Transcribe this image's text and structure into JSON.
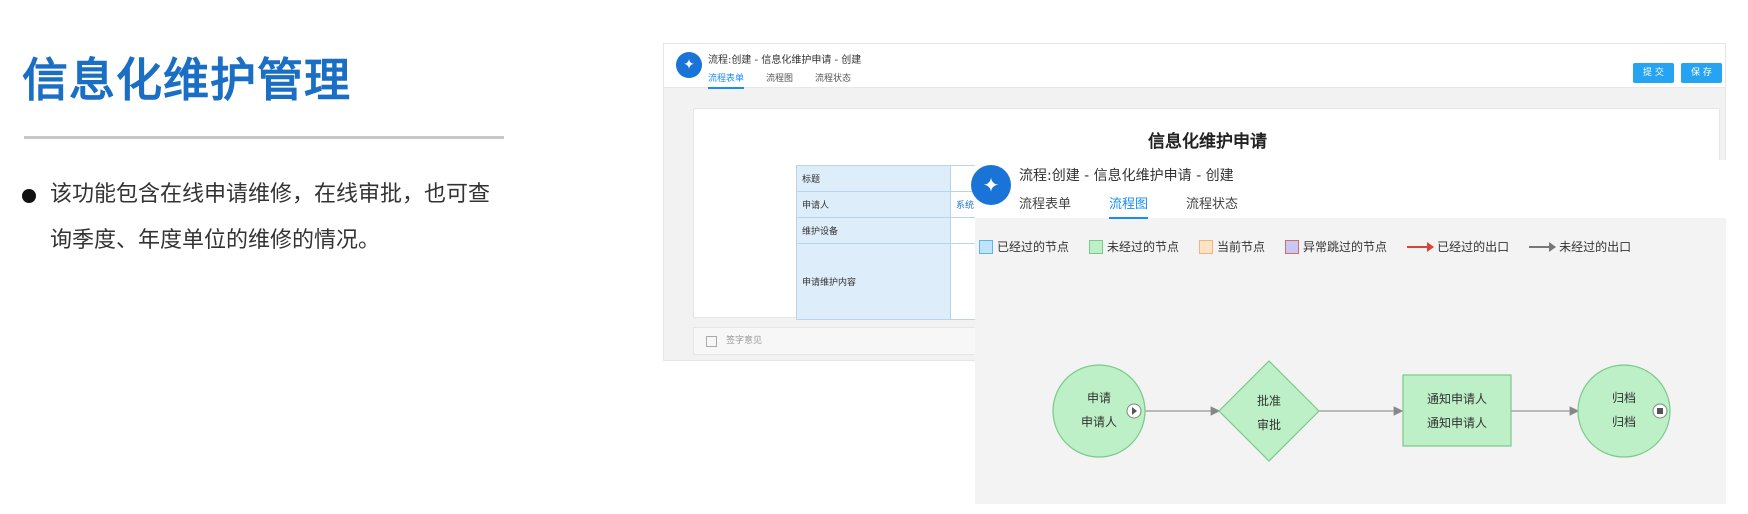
{
  "slide": {
    "title": "信息化维护管理",
    "bullet_line1": "该功能包含在线申请维修，在线审批，也可查",
    "bullet_line2": "询季度、年度单位的维修的情况。"
  },
  "back_window": {
    "title": "流程:创建 - 信息化维护申请 - 创建",
    "tabs": [
      "流程表单",
      "流程图",
      "流程状态"
    ],
    "submit_label": "提 交",
    "save_label": "保 存",
    "doc_title": "信息化维护申请",
    "fields": [
      "标题",
      "申请人",
      "维护设备",
      "申请维护内容"
    ],
    "applicant_value": "系统!",
    "footer_text": "签字意见"
  },
  "front_window": {
    "title": "流程:创建 - 信息化维护申请 - 创建",
    "tabs": [
      "流程表单",
      "流程图",
      "流程状态"
    ],
    "active_tab": "流程图",
    "legend": [
      {
        "label": "已经过的节点",
        "kind": "box",
        "fill": "#bfe3f9",
        "stroke": "#5bb6ea"
      },
      {
        "label": "未经过的节点",
        "kind": "box",
        "fill": "#bdf0c6",
        "stroke": "#7ac98a"
      },
      {
        "label": "当前节点",
        "kind": "box",
        "fill": "#fde3c5",
        "stroke": "#f0b57a"
      },
      {
        "label": "异常跳过的节点",
        "kind": "box",
        "fill": "#c8c8f2",
        "stroke": "#d96a6a"
      },
      {
        "label": "已经过的出口",
        "kind": "line",
        "color": "#d9443a"
      },
      {
        "label": "未经过的出口",
        "kind": "line",
        "color": "#777777"
      }
    ],
    "nodes": {
      "apply": {
        "name": "申请",
        "actor": "申请人"
      },
      "approve": {
        "name": "批准",
        "actor": "审批"
      },
      "notify": {
        "name": "通知申请人",
        "actor": "通知申请人"
      },
      "archive": {
        "name": "归档",
        "actor": "归档"
      }
    }
  },
  "colors": {
    "brand_blue": "#1a6fc4",
    "tab_active": "#1a8ef0",
    "node_fill": "#bdf0c6",
    "node_stroke": "#7ac98a"
  }
}
